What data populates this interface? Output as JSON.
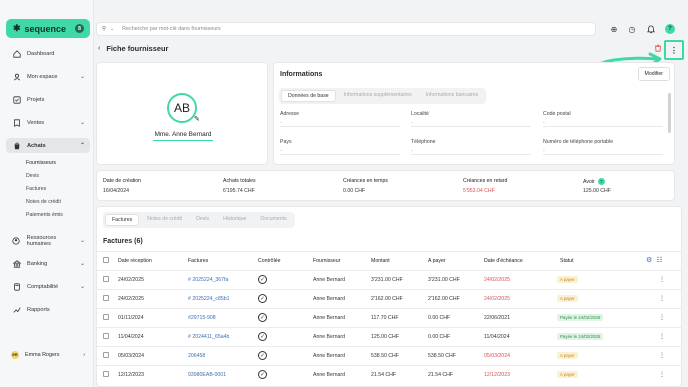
{
  "app": {
    "logo_text": "sequence",
    "logo_badge": "8"
  },
  "sidebar": {
    "items": [
      {
        "label": "Dashboard",
        "icon": "home-icon"
      },
      {
        "label": "Mon espace",
        "icon": "user-icon"
      },
      {
        "label": "Projets",
        "icon": "checkbox-icon"
      },
      {
        "label": "Ventes",
        "icon": "sales-icon"
      },
      {
        "label": "Achats",
        "icon": "cart-icon"
      },
      {
        "label": "Ressources humaines",
        "icon": "people-icon"
      },
      {
        "label": "Banking",
        "icon": "bank-icon"
      },
      {
        "label": "Comptabilité",
        "icon": "calculator-icon"
      },
      {
        "label": "Rapports",
        "icon": "chart-icon"
      }
    ],
    "sub_items": [
      "Fournisseurs",
      "Devis",
      "Factures",
      "Notes de crédit",
      "Paiements émis"
    ],
    "user": {
      "initials": "ER",
      "name": "Emma Rogers"
    }
  },
  "search": {
    "placeholder": "Recherche par mot-clé dans fournisseurs"
  },
  "header": {
    "title": "Fiche fournisseur"
  },
  "profile": {
    "initials": "AB",
    "name": "Mme. Anne Bernard"
  },
  "info": {
    "title": "Informations",
    "edit_label": "Modifier",
    "tabs": [
      "Données de base",
      "Informations supplémentaires",
      "Informations bancaires"
    ],
    "fields": [
      {
        "label": "Adresse",
        "value": "-"
      },
      {
        "label": "Localité",
        "value": "-"
      },
      {
        "label": "Code postal",
        "value": "-"
      },
      {
        "label": "Pays",
        "value": "-"
      },
      {
        "label": "Téléphone",
        "value": "-"
      },
      {
        "label": "Numéro de téléphone portable",
        "value": "-"
      }
    ]
  },
  "stats": [
    {
      "label": "Date de création",
      "value": "16/04/2024"
    },
    {
      "label": "Achats totales",
      "value": "6'195.74 CHF"
    },
    {
      "label": "Créances en temps",
      "value": "0.00 CHF"
    },
    {
      "label": "Créances en retard",
      "value": "5'953.04 CHF"
    },
    {
      "label": "Avoir",
      "value": "125.00 CHF"
    }
  ],
  "invoices": {
    "tabs": [
      "Factures",
      "Notes de crédit",
      "Devis",
      "Historique",
      "Documents"
    ],
    "title": "Factures (6)",
    "columns": [
      "Date réception",
      "Factures",
      "Contrôlée",
      "Fournisseur",
      "Montant",
      "A payer",
      "Date d'échéance",
      "Statut"
    ],
    "rows": [
      {
        "date": "24/02/2025",
        "ref": "# 2025224_367fa",
        "supplier": "Anne Bernard",
        "amount": "3'231.00 CHF",
        "due": "3'231.00 CHF",
        "due_date": "24/02/2025",
        "status": "A payer"
      },
      {
        "date": "24/02/2025",
        "ref": "# 2025224_c85b1",
        "supplier": "Anne Bernard",
        "amount": "2'162.00 CHF",
        "due": "2'162.00 CHF",
        "due_date": "24/02/2025",
        "status": "A payer"
      },
      {
        "date": "01/11/2024",
        "ref": "#29715-908",
        "supplier": "Anne Bernard",
        "amount": "117.70 CHF",
        "due": "0.00 CHF",
        "due_date": "22/06/2021",
        "status": "Payée le 24/02/2025"
      },
      {
        "date": "11/04/2024",
        "ref": "# 2024411_65a4b",
        "supplier": "Anne Bernard",
        "amount": "125.00 CHF",
        "due": "0.00 CHF",
        "due_date": "11/04/2024",
        "status": "Payée le 24/02/2025"
      },
      {
        "date": "05/03/2024",
        "ref": "206458",
        "supplier": "Anne Bernard",
        "amount": "538.50 CHF",
        "due": "538.50 CHF",
        "due_date": "05/03/2024",
        "status": "A payer"
      },
      {
        "date": "12/12/2023",
        "ref": "93980EAB-0001",
        "supplier": "Anne Bernard",
        "amount": "21.54 CHF",
        "due": "21.54 CHF",
        "due_date": "12/12/2023",
        "status": "A payer"
      }
    ]
  },
  "colors": {
    "accent": "#3fd9a8",
    "danger": "#d9534f",
    "link": "#3b6fb6"
  }
}
